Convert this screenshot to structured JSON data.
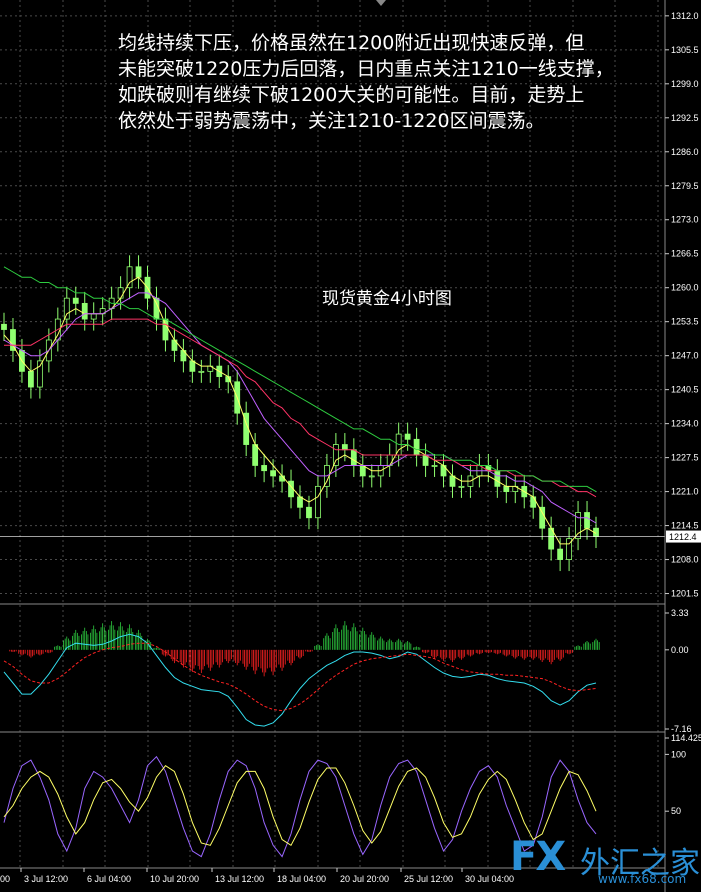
{
  "commentary": "均线持续下压，价格虽然在1200附近出现快速反弹，但\n未能突破1220压力后回落，日内重点关注1210一线支撑，\n如跌破则有继续下破1200大关的可能性。目前，走势上\n依然处于弱势震荡中，关注1210-1220区间震荡。",
  "main_title": "现货黄金4小时图",
  "watermark": {
    "brand": "FX",
    "name": "外汇之家",
    "url": "www.fx68.com"
  },
  "colors": {
    "background": "#000000",
    "grid": "#4a4a4a",
    "axis_text": "#ffffff",
    "bull_candle": "#90ff70",
    "bear_candle": "#90ff70",
    "ma_fast": "#ffff66",
    "ma_mid": "#c060ff",
    "ma_slow": "#ff3366",
    "ma_long": "#2ecc40",
    "macd_pos": "#2ecc40",
    "macd_neg": "#ff2222",
    "macd_line": "#33ddee",
    "signal_line": "#ff2222",
    "stoch_k": "#9966ff",
    "stoch_d": "#ffff66",
    "current_price": "#ffffff"
  },
  "chart_data": [
    {
      "type": "candlestick",
      "title": "现货黄金4小时图",
      "ylim": [
        1199.5,
        1313.5
      ],
      "y_ticks": [
        "1312.0",
        "1305.5",
        "1299.0",
        "1292.5",
        "1286.0",
        "1279.5",
        "1273.0",
        "1266.5",
        "1260.0",
        "1253.5",
        "1247.0",
        "1240.5",
        "1234.0",
        "1227.5",
        "1221.0",
        "1214.5",
        "1208.0",
        "1201.5"
      ],
      "current_price_label": "1212.4",
      "current_price": 1212.4,
      "x_ticks": [
        "3 Jul 12:00",
        "6 Jul 04:00",
        "10 Jul 20:00",
        "13 Jul 12:00",
        "18 Jul 04:00",
        "20 Jul 20:00",
        "25 Jul 12:00",
        "30 Jul 04:00"
      ],
      "x_ticks_truncated_left": "00",
      "closes": [
        1252,
        1248,
        1244,
        1241,
        1246,
        1250,
        1254,
        1258,
        1257,
        1254,
        1255,
        1256,
        1258,
        1260,
        1264,
        1262,
        1258,
        1254,
        1250,
        1248,
        1246,
        1244,
        1244,
        1245,
        1243,
        1242,
        1236,
        1230,
        1226,
        1225,
        1224,
        1223,
        1220,
        1218,
        1216,
        1222,
        1226,
        1230,
        1229,
        1226,
        1224,
        1224,
        1226,
        1228,
        1232,
        1231,
        1228,
        1226,
        1226,
        1224,
        1222,
        1222,
        1224,
        1226,
        1225,
        1222,
        1221,
        1222,
        1220,
        1218,
        1214,
        1210,
        1208,
        1212,
        1217,
        1214,
        1212.4
      ],
      "series": [
        {
          "name": "MA fast",
          "values": [
            1251,
            1249,
            1246,
            1244,
            1245,
            1248,
            1251,
            1255,
            1256,
            1255,
            1255,
            1255,
            1256,
            1258,
            1261,
            1262,
            1260,
            1257,
            1253,
            1250,
            1248,
            1246,
            1245,
            1245,
            1244,
            1243,
            1239,
            1234,
            1230,
            1228,
            1226,
            1224,
            1222,
            1220,
            1219,
            1220,
            1223,
            1227,
            1228,
            1227,
            1226,
            1225,
            1225,
            1226,
            1229,
            1230,
            1229,
            1228,
            1227,
            1226,
            1224,
            1223,
            1223,
            1224,
            1224,
            1223,
            1222,
            1222,
            1221,
            1220,
            1217,
            1214,
            1211,
            1211,
            1213,
            1214,
            1213
          ]
        },
        {
          "name": "MA mid",
          "values": [
            1250,
            1249,
            1248,
            1247,
            1247,
            1248,
            1250,
            1252,
            1254,
            1255,
            1255,
            1255,
            1256,
            1257,
            1258,
            1259,
            1259,
            1258,
            1257,
            1255,
            1253,
            1251,
            1249,
            1248,
            1247,
            1246,
            1244,
            1241,
            1238,
            1235,
            1233,
            1231,
            1229,
            1227,
            1225,
            1224,
            1224,
            1225,
            1226,
            1226,
            1226,
            1226,
            1226,
            1226,
            1227,
            1228,
            1228,
            1228,
            1228,
            1228,
            1227,
            1226,
            1225,
            1225,
            1225,
            1224,
            1224,
            1223,
            1223,
            1222,
            1221,
            1219,
            1218,
            1217,
            1216,
            1216,
            1215
          ]
        },
        {
          "name": "MA slow",
          "values": [
            1249,
            1249,
            1249,
            1249,
            1250,
            1251,
            1252,
            1253,
            1253,
            1253,
            1253,
            1253,
            1254,
            1254,
            1254,
            1254,
            1254,
            1253,
            1253,
            1252,
            1251,
            1250,
            1249,
            1248,
            1247,
            1246,
            1245,
            1243,
            1242,
            1240,
            1238,
            1237,
            1235,
            1234,
            1232,
            1231,
            1230,
            1229,
            1229,
            1229,
            1228,
            1228,
            1228,
            1228,
            1228,
            1228,
            1228,
            1228,
            1227,
            1227,
            1227,
            1226,
            1226,
            1226,
            1225,
            1225,
            1225,
            1224,
            1224,
            1224,
            1223,
            1223,
            1222,
            1222,
            1221,
            1221,
            1220
          ]
        },
        {
          "name": "MA long",
          "values": [
            1264,
            1263,
            1262,
            1262,
            1261,
            1261,
            1260,
            1260,
            1259,
            1259,
            1258,
            1258,
            1257,
            1257,
            1256,
            1256,
            1255,
            1254,
            1254,
            1253,
            1252,
            1251,
            1250,
            1249,
            1248,
            1247,
            1246,
            1245,
            1244,
            1243,
            1242,
            1241,
            1240,
            1239,
            1238,
            1237,
            1236,
            1235,
            1234,
            1233,
            1233,
            1232,
            1231,
            1231,
            1230,
            1230,
            1229,
            1229,
            1228,
            1228,
            1227,
            1227,
            1227,
            1226,
            1226,
            1225,
            1225,
            1225,
            1224,
            1224,
            1223,
            1223,
            1223,
            1222,
            1222,
            1222,
            1221
          ]
        }
      ]
    },
    {
      "type": "macd",
      "ylim": [
        -7.16,
        3.33
      ],
      "y_ticks": [
        "3.33",
        "0.00",
        "-7.16"
      ],
      "histogram": [
        0,
        -0.2,
        -0.5,
        -0.7,
        -0.5,
        -0.3,
        0.4,
        1.2,
        1.8,
        2.0,
        2.2,
        2.4,
        2.6,
        2.5,
        2.3,
        1.8,
        1.0,
        0.2,
        -0.6,
        -1.2,
        -1.6,
        -2.0,
        -2.1,
        -1.9,
        -1.6,
        -1.2,
        -1.4,
        -1.8,
        -2.2,
        -2.4,
        -2.3,
        -1.9,
        -1.4,
        -0.8,
        -0.2,
        0.5,
        1.5,
        2.3,
        2.6,
        2.4,
        2.0,
        1.6,
        1.2,
        1.0,
        1.0,
        0.8,
        0.3,
        -0.3,
        -0.8,
        -1.0,
        -1.1,
        -0.9,
        -0.6,
        -0.4,
        -0.3,
        -0.4,
        -0.6,
        -0.8,
        -0.9,
        -0.9,
        -1.1,
        -1.3,
        -1.0,
        -0.4,
        0.4,
        0.8,
        1.0
      ],
      "series": [
        {
          "name": "MACD",
          "values": [
            -2.0,
            -3.0,
            -4.0,
            -4.0,
            -3.2,
            -2.2,
            -1.0,
            0.2,
            0.6,
            0.5,
            0.4,
            0.5,
            0.8,
            1.2,
            1.4,
            1.2,
            0.6,
            -0.5,
            -1.6,
            -2.5,
            -3.0,
            -3.3,
            -3.6,
            -3.7,
            -3.8,
            -4.2,
            -5.2,
            -6.3,
            -6.8,
            -6.9,
            -6.6,
            -5.8,
            -4.6,
            -3.5,
            -2.6,
            -2.0,
            -1.4,
            -1.0,
            -0.5,
            -0.2,
            -0.2,
            -0.3,
            -0.5,
            -0.8,
            -0.6,
            -0.2,
            -0.4,
            -1.0,
            -1.6,
            -2.1,
            -2.4,
            -2.5,
            -2.4,
            -2.2,
            -2.3,
            -2.6,
            -2.8,
            -2.9,
            -3.0,
            -3.3,
            -3.8,
            -4.6,
            -5.0,
            -4.6,
            -3.8,
            -3.2,
            -3.0
          ]
        },
        {
          "name": "Signal",
          "values": [
            -1.0,
            -1.5,
            -2.2,
            -2.8,
            -3.0,
            -3.0,
            -2.6,
            -2.0,
            -1.3,
            -0.7,
            -0.3,
            0.0,
            0.2,
            0.3,
            0.5,
            0.6,
            0.6,
            0.3,
            -0.2,
            -0.8,
            -1.4,
            -1.9,
            -2.3,
            -2.6,
            -2.9,
            -3.1,
            -3.5,
            -4.0,
            -4.6,
            -5.1,
            -5.4,
            -5.5,
            -5.3,
            -4.9,
            -4.3,
            -3.6,
            -2.9,
            -2.3,
            -1.8,
            -1.3,
            -1.0,
            -0.8,
            -0.7,
            -0.6,
            -0.5,
            -0.4,
            -0.5,
            -0.6,
            -0.8,
            -1.2,
            -1.5,
            -1.8,
            -2.0,
            -2.1,
            -2.2,
            -2.2,
            -2.3,
            -2.3,
            -2.4,
            -2.5,
            -2.6,
            -2.9,
            -3.3,
            -3.6,
            -3.7,
            -3.6,
            -3.5
          ]
        }
      ]
    },
    {
      "type": "line",
      "ylim": [
        0,
        114.42
      ],
      "y_ticks": [
        "114.425",
        "100",
        "50"
      ],
      "series": [
        {
          "name": "%K",
          "values": [
            40,
            70,
            90,
            95,
            80,
            60,
            30,
            15,
            35,
            70,
            85,
            80,
            70,
            55,
            40,
            60,
            90,
            98,
            85,
            60,
            35,
            15,
            10,
            30,
            60,
            85,
            95,
            90,
            70,
            40,
            20,
            10,
            30,
            60,
            85,
            95,
            92,
            80,
            55,
            30,
            12,
            25,
            55,
            80,
            92,
            95,
            85,
            60,
            35,
            15,
            25,
            50,
            70,
            85,
            90,
            80,
            55,
            35,
            15,
            20,
            45,
            80,
            95,
            85,
            60,
            40,
            30
          ]
        },
        {
          "name": "%D",
          "values": [
            45,
            55,
            70,
            80,
            85,
            80,
            65,
            45,
            30,
            40,
            60,
            75,
            78,
            70,
            58,
            50,
            62,
            80,
            90,
            85,
            65,
            40,
            22,
            20,
            35,
            55,
            75,
            85,
            85,
            70,
            45,
            25,
            20,
            35,
            58,
            78,
            88,
            88,
            75,
            55,
            33,
            22,
            32,
            52,
            72,
            85,
            88,
            80,
            62,
            40,
            27,
            30,
            45,
            65,
            78,
            85,
            78,
            60,
            40,
            25,
            30,
            50,
            70,
            85,
            82,
            68,
            50
          ]
        }
      ]
    }
  ]
}
